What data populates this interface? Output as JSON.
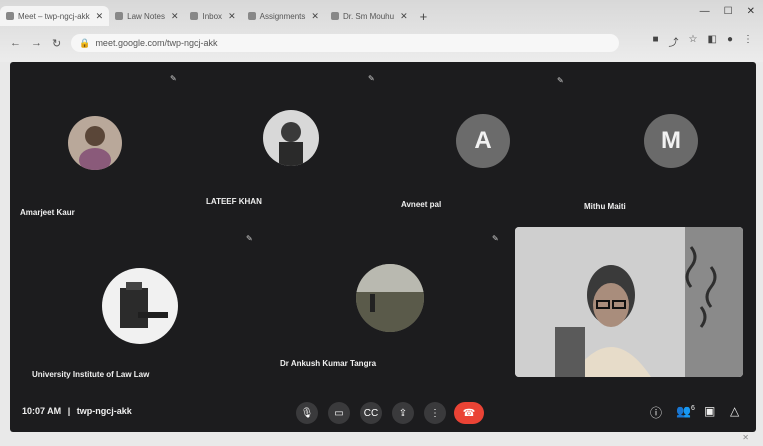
{
  "browser": {
    "tabs": [
      {
        "label": "Meet – twp-ngcj-akk"
      },
      {
        "label": "Law Notes"
      },
      {
        "label": "Inbox"
      },
      {
        "label": "Assignments"
      },
      {
        "label": "Dr. Sm Mouhu"
      }
    ],
    "new_tab": "+",
    "url": "meet.google.com/twp-ngcj-akk",
    "window_controls": [
      "—",
      "☐",
      "✕"
    ]
  },
  "participants": [
    {
      "name": "Amarjeet Kaur",
      "type": "photo"
    },
    {
      "name": "LATEEF KHAN",
      "type": "photo"
    },
    {
      "name": "Avneet pal",
      "type": "letter",
      "letter": "A",
      "color": "#6b6b6b"
    },
    {
      "name": "Mithu Maiti",
      "type": "letter",
      "letter": "M",
      "color": "#6a6a6a"
    },
    {
      "name": "University Institute of Law Law",
      "type": "gavel"
    },
    {
      "name": "Dr Ankush Kumar Tangra",
      "type": "photo"
    }
  ],
  "meeting": {
    "time": "10:07 AM",
    "separator": "|",
    "code": "twp-ngcj-akk"
  },
  "controls": {
    "mic": "mic-icon",
    "camera": "camera-icon",
    "captions": "captions-icon",
    "present": "present-icon",
    "more": "more-options-icon",
    "leave": "leave-call-icon"
  },
  "right_icons": {
    "info": "ⓘ",
    "people_count": "6",
    "chat": "chat-icon",
    "activities": "activities-icon"
  }
}
